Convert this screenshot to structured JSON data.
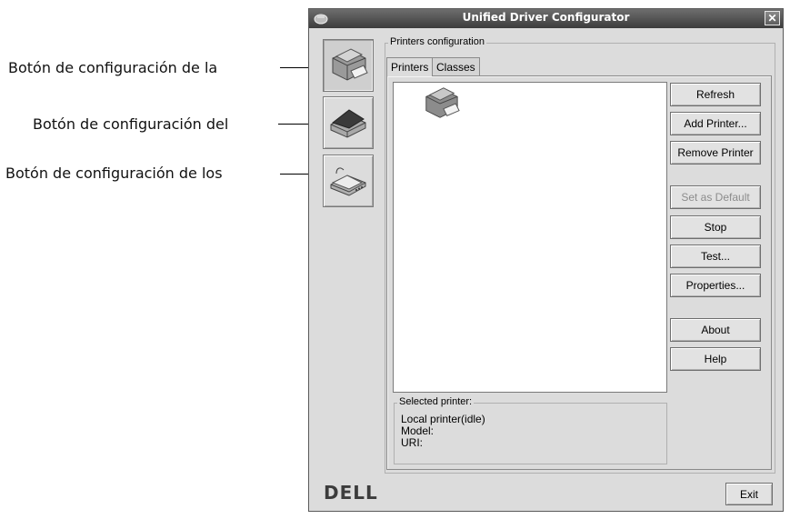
{
  "callouts": [
    "Botón de configuración de la",
    "Botón de configuración del",
    "Botón de configuración de los"
  ],
  "window": {
    "title": "Unified Driver Configurator",
    "close_glyph": "✕"
  },
  "sidebar": [
    {
      "icon": "printer-icon"
    },
    {
      "icon": "scanner-icon"
    },
    {
      "icon": "port-icon"
    }
  ],
  "printers_config": {
    "group_title": "Printers configuration",
    "tabs": [
      "Printers",
      "Classes"
    ],
    "active_tab": "Printers"
  },
  "buttons": {
    "refresh": "Refresh",
    "add_printer": "Add Printer...",
    "remove_printer": "Remove Printer",
    "set_default": "Set as Default",
    "stop": "Stop",
    "test": "Test...",
    "properties": "Properties...",
    "about": "About",
    "help": "Help",
    "exit": "Exit"
  },
  "selected_printer": {
    "title": "Selected printer:",
    "line1": "Local printer(idle)",
    "line2": "Model:",
    "line3": "URI:"
  },
  "brand": "DÉLL",
  "brand_text": "DELL"
}
